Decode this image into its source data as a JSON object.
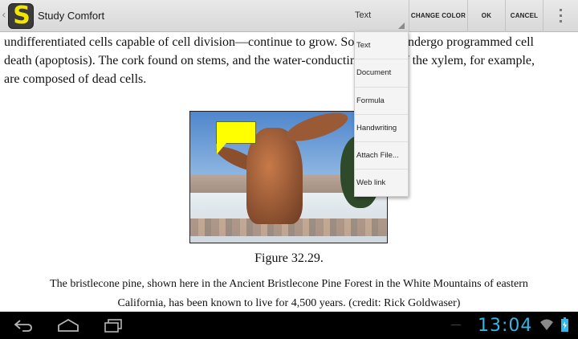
{
  "app": {
    "title": "Study Comfort",
    "icon_letter": "S",
    "back_glyph": "‹"
  },
  "toolbar": {
    "spinner_value": "Text",
    "change_color_label": "CHANGE COLOR",
    "ok_label": "OK",
    "cancel_label": "CANCEL"
  },
  "dropdown": {
    "items": [
      "Text",
      "Document",
      "Formula",
      "Handwriting",
      "Attach File...",
      "Web link"
    ]
  },
  "content": {
    "lines": [
      "undifferentiated cells capable of cell division—continue to grow. Some parts undergo programmed cell",
      "death (apoptosis). The cork found on stems, and the water-conducting tissue of the xylem, for example,",
      "are composed of dead cells."
    ],
    "caption": "Figure 32.29.",
    "body_lines": [
      "The bristlecone pine, shown here in the Ancient Bristlecone Pine Forest in the White Mountains of eastern",
      "California, has been known to live for 4,500 years. (credit: Rick Goldwaser)"
    ]
  },
  "system": {
    "clock": "13:04"
  },
  "colors": {
    "accent": "#33b5e5",
    "callout": "#ffff00",
    "icon_letter": "#f2e600"
  },
  "icons": [
    "back-nav-icon",
    "home-nav-icon",
    "recent-apps-icon",
    "wifi-icon",
    "battery-icon",
    "overflow-menu-icon"
  ]
}
